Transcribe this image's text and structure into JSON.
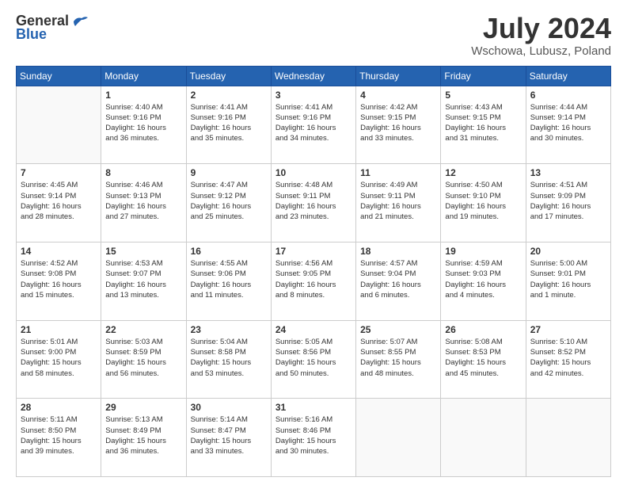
{
  "logo": {
    "general": "General",
    "blue": "Blue"
  },
  "title": {
    "month": "July 2024",
    "location": "Wschowa, Lubusz, Poland"
  },
  "weekdays": [
    "Sunday",
    "Monday",
    "Tuesday",
    "Wednesday",
    "Thursday",
    "Friday",
    "Saturday"
  ],
  "weeks": [
    [
      {
        "day": "",
        "info": ""
      },
      {
        "day": "1",
        "info": "Sunrise: 4:40 AM\nSunset: 9:16 PM\nDaylight: 16 hours\nand 36 minutes."
      },
      {
        "day": "2",
        "info": "Sunrise: 4:41 AM\nSunset: 9:16 PM\nDaylight: 16 hours\nand 35 minutes."
      },
      {
        "day": "3",
        "info": "Sunrise: 4:41 AM\nSunset: 9:16 PM\nDaylight: 16 hours\nand 34 minutes."
      },
      {
        "day": "4",
        "info": "Sunrise: 4:42 AM\nSunset: 9:15 PM\nDaylight: 16 hours\nand 33 minutes."
      },
      {
        "day": "5",
        "info": "Sunrise: 4:43 AM\nSunset: 9:15 PM\nDaylight: 16 hours\nand 31 minutes."
      },
      {
        "day": "6",
        "info": "Sunrise: 4:44 AM\nSunset: 9:14 PM\nDaylight: 16 hours\nand 30 minutes."
      }
    ],
    [
      {
        "day": "7",
        "info": "Sunrise: 4:45 AM\nSunset: 9:14 PM\nDaylight: 16 hours\nand 28 minutes."
      },
      {
        "day": "8",
        "info": "Sunrise: 4:46 AM\nSunset: 9:13 PM\nDaylight: 16 hours\nand 27 minutes."
      },
      {
        "day": "9",
        "info": "Sunrise: 4:47 AM\nSunset: 9:12 PM\nDaylight: 16 hours\nand 25 minutes."
      },
      {
        "day": "10",
        "info": "Sunrise: 4:48 AM\nSunset: 9:11 PM\nDaylight: 16 hours\nand 23 minutes."
      },
      {
        "day": "11",
        "info": "Sunrise: 4:49 AM\nSunset: 9:11 PM\nDaylight: 16 hours\nand 21 minutes."
      },
      {
        "day": "12",
        "info": "Sunrise: 4:50 AM\nSunset: 9:10 PM\nDaylight: 16 hours\nand 19 minutes."
      },
      {
        "day": "13",
        "info": "Sunrise: 4:51 AM\nSunset: 9:09 PM\nDaylight: 16 hours\nand 17 minutes."
      }
    ],
    [
      {
        "day": "14",
        "info": "Sunrise: 4:52 AM\nSunset: 9:08 PM\nDaylight: 16 hours\nand 15 minutes."
      },
      {
        "day": "15",
        "info": "Sunrise: 4:53 AM\nSunset: 9:07 PM\nDaylight: 16 hours\nand 13 minutes."
      },
      {
        "day": "16",
        "info": "Sunrise: 4:55 AM\nSunset: 9:06 PM\nDaylight: 16 hours\nand 11 minutes."
      },
      {
        "day": "17",
        "info": "Sunrise: 4:56 AM\nSunset: 9:05 PM\nDaylight: 16 hours\nand 8 minutes."
      },
      {
        "day": "18",
        "info": "Sunrise: 4:57 AM\nSunset: 9:04 PM\nDaylight: 16 hours\nand 6 minutes."
      },
      {
        "day": "19",
        "info": "Sunrise: 4:59 AM\nSunset: 9:03 PM\nDaylight: 16 hours\nand 4 minutes."
      },
      {
        "day": "20",
        "info": "Sunrise: 5:00 AM\nSunset: 9:01 PM\nDaylight: 16 hours\nand 1 minute."
      }
    ],
    [
      {
        "day": "21",
        "info": "Sunrise: 5:01 AM\nSunset: 9:00 PM\nDaylight: 15 hours\nand 58 minutes."
      },
      {
        "day": "22",
        "info": "Sunrise: 5:03 AM\nSunset: 8:59 PM\nDaylight: 15 hours\nand 56 minutes."
      },
      {
        "day": "23",
        "info": "Sunrise: 5:04 AM\nSunset: 8:58 PM\nDaylight: 15 hours\nand 53 minutes."
      },
      {
        "day": "24",
        "info": "Sunrise: 5:05 AM\nSunset: 8:56 PM\nDaylight: 15 hours\nand 50 minutes."
      },
      {
        "day": "25",
        "info": "Sunrise: 5:07 AM\nSunset: 8:55 PM\nDaylight: 15 hours\nand 48 minutes."
      },
      {
        "day": "26",
        "info": "Sunrise: 5:08 AM\nSunset: 8:53 PM\nDaylight: 15 hours\nand 45 minutes."
      },
      {
        "day": "27",
        "info": "Sunrise: 5:10 AM\nSunset: 8:52 PM\nDaylight: 15 hours\nand 42 minutes."
      }
    ],
    [
      {
        "day": "28",
        "info": "Sunrise: 5:11 AM\nSunset: 8:50 PM\nDaylight: 15 hours\nand 39 minutes."
      },
      {
        "day": "29",
        "info": "Sunrise: 5:13 AM\nSunset: 8:49 PM\nDaylight: 15 hours\nand 36 minutes."
      },
      {
        "day": "30",
        "info": "Sunrise: 5:14 AM\nSunset: 8:47 PM\nDaylight: 15 hours\nand 33 minutes."
      },
      {
        "day": "31",
        "info": "Sunrise: 5:16 AM\nSunset: 8:46 PM\nDaylight: 15 hours\nand 30 minutes."
      },
      {
        "day": "",
        "info": ""
      },
      {
        "day": "",
        "info": ""
      },
      {
        "day": "",
        "info": ""
      }
    ]
  ]
}
